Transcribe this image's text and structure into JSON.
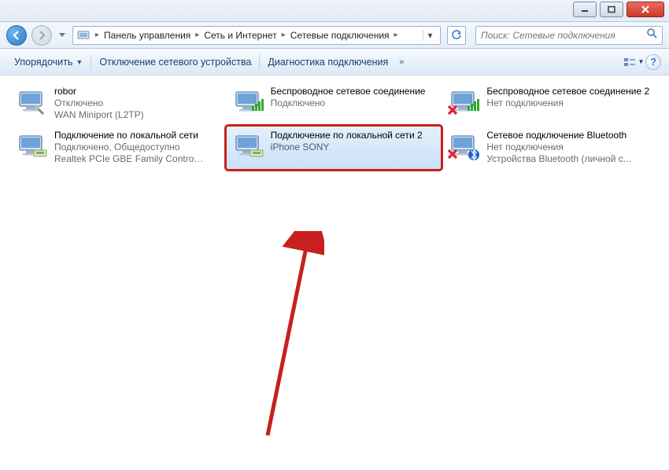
{
  "titlebar": {
    "minimize": "",
    "maximize": "",
    "close": ""
  },
  "nav": {
    "breadcrumb": [
      "Панель управления",
      "Сеть и Интернет",
      "Сетевые подключения"
    ],
    "search_placeholder": "Поиск: Сетевые подключения"
  },
  "toolbar": {
    "organize": "Упорядочить",
    "disable": "Отключение сетевого устройства",
    "diagnose": "Диагностика подключения"
  },
  "connections": [
    {
      "name": "robor",
      "status": "Отключено",
      "detail": "WAN Miniport (L2TP)",
      "icon": "plug-disabled",
      "selected": false,
      "highlighted": false,
      "overlay": null
    },
    {
      "name": "Беспроводное сетевое соединение",
      "status": "Подключено",
      "detail": "",
      "icon": "wifi-on",
      "selected": false,
      "highlighted": false,
      "overlay": null
    },
    {
      "name": "Беспроводное сетевое соединение 2",
      "status": "Нет подключения",
      "detail": "",
      "icon": "wifi-off",
      "selected": false,
      "highlighted": false,
      "overlay": "x"
    },
    {
      "name": "Подключение по локальной сети",
      "status": "Подключено, Общедоступно",
      "detail": "Realtek PCIe GBE Family Controller",
      "icon": "lan-on",
      "selected": false,
      "highlighted": false,
      "overlay": null
    },
    {
      "name": "Подключение по локальной сети 2",
      "status": "",
      "detail": "iPhone SONY",
      "icon": "lan-on",
      "selected": true,
      "highlighted": true,
      "overlay": null
    },
    {
      "name": "Сетевое подключение Bluetooth",
      "status": "Нет подключения",
      "detail": "Устройства Bluetooth (личной с...",
      "icon": "bluetooth",
      "selected": false,
      "highlighted": false,
      "overlay": "x-bt"
    }
  ],
  "colors": {
    "highlight": "#c8201e",
    "selection": "#c9e1f8"
  }
}
